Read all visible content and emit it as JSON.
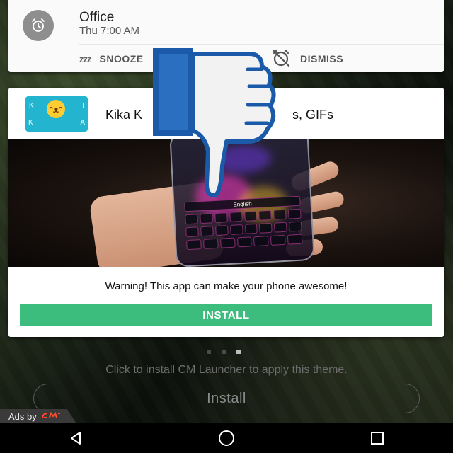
{
  "alarm": {
    "title": "Office",
    "time": "Thu 7:00 AM",
    "snooze_label": "SNOOZE",
    "snooze_icon": "zzz",
    "dismiss_label": "DISMISS",
    "icons": {
      "alarm": "alarm-clock-icon",
      "dismiss": "alarm-off-icon"
    }
  },
  "ad": {
    "app_title": "Kika Keyboard - Emoji, GIFs",
    "app_title_visible": "Kika K",
    "app_title_tail": "s, GIFs",
    "app_icon_letters": [
      "K",
      "I",
      "K",
      "A"
    ],
    "keyboard_label": "English",
    "warning": "Warning!  This app can make your phone awesome!",
    "install_label": "INSTALL",
    "install_color": "#3dbd7d"
  },
  "overlay": {
    "icon": "thumbs-down-icon",
    "fill": "#f2f2f2",
    "stroke": "#1a5aa8"
  },
  "pager": {
    "count": 3,
    "active_index": 2
  },
  "theme": {
    "prompt": "Click to install CM Launcher to apply this theme.",
    "install_label": "Install"
  },
  "ads_by": {
    "label": "Ads by",
    "brand": "cm"
  },
  "navbar": {
    "icons": [
      "back-icon",
      "home-icon",
      "recents-icon"
    ]
  }
}
